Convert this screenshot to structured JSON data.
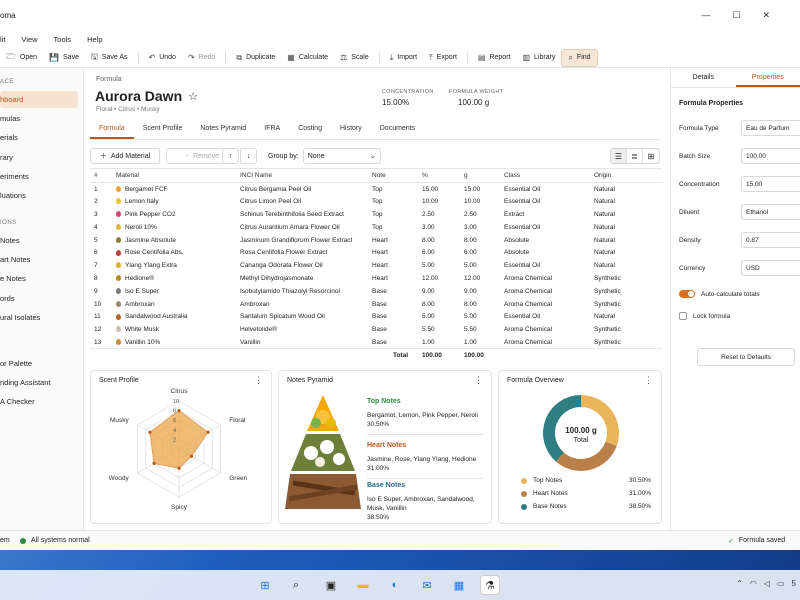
{
  "app": {
    "title": "oma"
  },
  "menu": [
    "lit",
    "View",
    "Tools",
    "Help"
  ],
  "toolbar": [
    {
      "label": "Open",
      "icon": "folder-open-icon",
      "glyph": "🗁"
    },
    {
      "label": "Save",
      "icon": "save-icon",
      "glyph": "💾"
    },
    {
      "label": "Save As",
      "icon": "save-as-icon",
      "glyph": "🖫"
    },
    {
      "label": "Undo",
      "icon": "undo-icon",
      "glyph": "↶"
    },
    {
      "label": "Redo",
      "icon": "redo-icon",
      "glyph": "↷",
      "disabled": true
    },
    {
      "label": "Duplicate",
      "icon": "duplicate-icon",
      "glyph": "⧉"
    },
    {
      "label": "Calculate",
      "icon": "calculator-icon",
      "glyph": "▦"
    },
    {
      "label": "Scale",
      "icon": "scale-icon",
      "glyph": "⚖"
    },
    {
      "label": "Import",
      "icon": "import-icon",
      "glyph": "⤓"
    },
    {
      "label": "Export",
      "icon": "export-icon",
      "glyph": "⤒"
    },
    {
      "label": "Report",
      "icon": "report-icon",
      "glyph": "▤"
    },
    {
      "label": "Library",
      "icon": "library-icon",
      "glyph": "▥"
    },
    {
      "label": "Find",
      "icon": "search-icon",
      "glyph": "⌕",
      "highlight": true
    }
  ],
  "sidebar": {
    "head1": "ACE",
    "items1": [
      "hboard",
      "mulas",
      "erials",
      "rary",
      "eriments",
      "luations"
    ],
    "head2": "IONS",
    "items2": [
      "Notes",
      "art Notes",
      "e Notes",
      "ords",
      "ural Isolates"
    ],
    "items3": [
      "or Palette",
      "nding Assistant",
      "A Checker"
    ]
  },
  "formula": {
    "breadcrumb": "Formula",
    "name": "Aurora Dawn",
    "subtitle": "Floral • Citrus • Musky",
    "concentration_label": "CONCENTRATION",
    "concentration": "15.00%",
    "weight_label": "FORMULA WEIGHT",
    "weight": "100.00 g"
  },
  "tabs": [
    "Formula",
    "Scent Profile",
    "Notes Pyramid",
    "IFRA",
    "Costing",
    "History",
    "Documents"
  ],
  "actions": {
    "add": "Add Material",
    "remove": "Remove",
    "group_label": "Group by:",
    "group_value": "None"
  },
  "table": {
    "headers": [
      "#",
      "Material",
      "INCI Name",
      "Note",
      "%",
      "g",
      "Class",
      "Origin"
    ],
    "rows": [
      [
        "1",
        "Bergamot FCF",
        "Citrus Bergamia Peel Oil",
        "Top",
        "15.00",
        "15.00",
        "Essential Oil",
        "Natural",
        "#e8a52c"
      ],
      [
        "2",
        "Lemon Italy",
        "Citrus Limon Peel Oil",
        "Top",
        "10.00",
        "10.00",
        "Essential Oil",
        "Natural",
        "#e8c42c"
      ],
      [
        "3",
        "Pink Pepper CO2",
        "Schinus Terebinthifolia Seed Extract",
        "Top",
        "2.50",
        "2.50",
        "Extract",
        "Natural",
        "#d9447a"
      ],
      [
        "4",
        "Neroli 10%",
        "Citrus Aurantium Amara Flower Oil",
        "Top",
        "3.00",
        "3.00",
        "Essential Oil",
        "Natural",
        "#e9b43a"
      ],
      [
        "5",
        "Jasmine Absolute",
        "Jasminum Grandiflorum Flower Extract",
        "Heart",
        "8.00",
        "8.00",
        "Absolute",
        "Natural",
        "#8a7a3a"
      ],
      [
        "6",
        "Rose Centifolia Abs.",
        "Rosa Centifolia Flower Extract",
        "Heart",
        "6.00",
        "6.00",
        "Absolute",
        "Natural",
        "#c43b3b"
      ],
      [
        "7",
        "Ylang Ylang Extra",
        "Cananga Odorata Flower Oil",
        "Heart",
        "5.00",
        "5.00",
        "Essential Oil",
        "Natural",
        "#d9b02a"
      ],
      [
        "8",
        "Hedione®",
        "Methyl Dihydrojasmonate",
        "Heart",
        "12.00",
        "12.00",
        "Aroma Chemical",
        "Synthetic",
        "#b58a2a"
      ],
      [
        "9",
        "Iso E Super",
        "Isobutylamido Thiazolyl Resorcinol",
        "Base",
        "9.00",
        "9.00",
        "Aroma Chemical",
        "Synthetic",
        "#7a7a7a"
      ],
      [
        "10",
        "Ambroxan",
        "Ambroxan",
        "Base",
        "8.00",
        "8.00",
        "Aroma Chemical",
        "Synthetic",
        "#9a8a6a"
      ],
      [
        "11",
        "Sandalwood Australia",
        "Santalum Spicatum Wood Oil",
        "Base",
        "5.00",
        "5.00",
        "Essential Oil",
        "Natural",
        "#b5682a"
      ],
      [
        "12",
        "White Musk",
        "Helvetolide®",
        "Base",
        "5.50",
        "5.50",
        "Aroma Chemical",
        "Synthetic",
        "#c9c0b0"
      ],
      [
        "13",
        "Vanillin 10%",
        "Vanillin",
        "Base",
        "1.00",
        "1.00",
        "Aroma Chemical",
        "Synthetic",
        "#c98a3a"
      ]
    ],
    "total_label": "Total",
    "total_pct": "100.00",
    "total_g": "100.00"
  },
  "scent": {
    "title": "Scent Profile",
    "axes": [
      "Citrus",
      "Floral",
      "Green",
      "Spicy",
      "Woody",
      "Musky"
    ],
    "ticks": [
      "10",
      "8",
      "6",
      "4",
      "2"
    ],
    "values": [
      8,
      7,
      3,
      4,
      6,
      7
    ],
    "max": 10
  },
  "pyramid": {
    "title": "Notes Pyramid",
    "tiers": [
      {
        "name": "Top Notes",
        "items": "Bergamot, Lemon, Pink Pepper, Neroli",
        "pct": "30.50%",
        "color": "#2e8b3e"
      },
      {
        "name": "Heart Notes",
        "items": "Jasmine, Rose, Ylang Ylang, Hedione",
        "pct": "31.00%",
        "color": "#c0561a"
      },
      {
        "name": "Base Notes",
        "items": "Iso E Super, Ambroxan, Sandalwood, Musk, Vanillin",
        "pct": "38.50%",
        "color": "#1f6a8a"
      }
    ]
  },
  "overview": {
    "title": "Formula Overview",
    "center_value": "100.00 g",
    "center_label": "Total",
    "legend": [
      {
        "name": "Top Notes",
        "pct": "30.50%",
        "value": 30.5,
        "color": "#e9b45a"
      },
      {
        "name": "Heart Notes",
        "pct": "31.00%",
        "value": 31.0,
        "color": "#b9804a"
      },
      {
        "name": "Base Notes",
        "pct": "38.50%",
        "value": 38.5,
        "color": "#2f7f82"
      }
    ]
  },
  "right": {
    "tabs": [
      "Details",
      "Properties"
    ],
    "heading": "Formula Properties",
    "props": [
      [
        "Formula Type",
        "Eau de Parfum"
      ],
      [
        "Batch Size",
        "100.00"
      ],
      [
        "Concentration",
        "15.00"
      ],
      [
        "Diluent",
        "Ethanol"
      ],
      [
        "Density",
        "0.87"
      ],
      [
        "Currency",
        "USD"
      ]
    ],
    "auto_calc": "Auto-calculate totals",
    "lock": "Lock formula",
    "reset": "Reset to Defaults"
  },
  "status": {
    "left": "em",
    "system": "All systems normal",
    "saved": "Formula saved"
  },
  "tray": {
    "clock": "5"
  }
}
